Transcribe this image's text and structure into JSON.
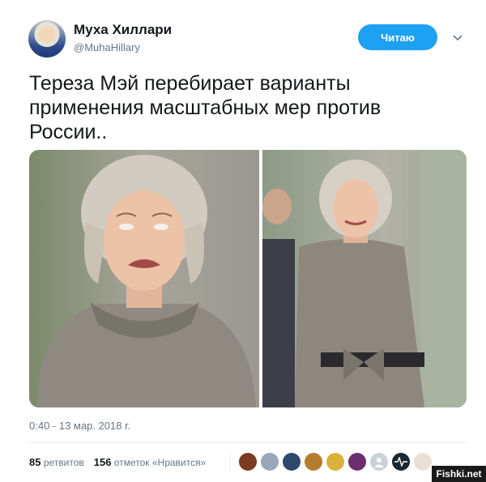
{
  "tweet": {
    "display_name": "Муха Хиллари",
    "handle": "@MuhaHillary",
    "follow_label": "Читаю",
    "text": "Тереза Мэй перебирает варианты применения масштабных мер против России..",
    "timestamp": "0:40 - 13 мар. 2018 г."
  },
  "stats": {
    "retweets_count": "85",
    "retweets_label": "ретвитов",
    "likes_count": "156",
    "likes_label": "отметок «Нравится»"
  },
  "likers": [
    {
      "icon": "avatar-icon",
      "color": "#7a3b1e"
    },
    {
      "icon": "avatar-icon",
      "color": "#9aa7b8"
    },
    {
      "icon": "avatar-icon",
      "color": "#2b4a6b"
    },
    {
      "icon": "avatar-icon",
      "color": "#b57c2c"
    },
    {
      "icon": "avatar-icon",
      "color": "#d8b23a"
    },
    {
      "icon": "avatar-icon",
      "color": "#6b2f6f"
    },
    {
      "icon": "default-avatar-icon",
      "color": "#c9d1d9"
    },
    {
      "icon": "waveform-icon",
      "color": "#1b2733"
    },
    {
      "icon": "avatar-icon",
      "color": "#e9e2d4"
    }
  ],
  "watermark": "Fishki.net",
  "colors": {
    "accent": "#1da1f2",
    "secondary_text": "#657786",
    "primary_text": "#14171a"
  }
}
